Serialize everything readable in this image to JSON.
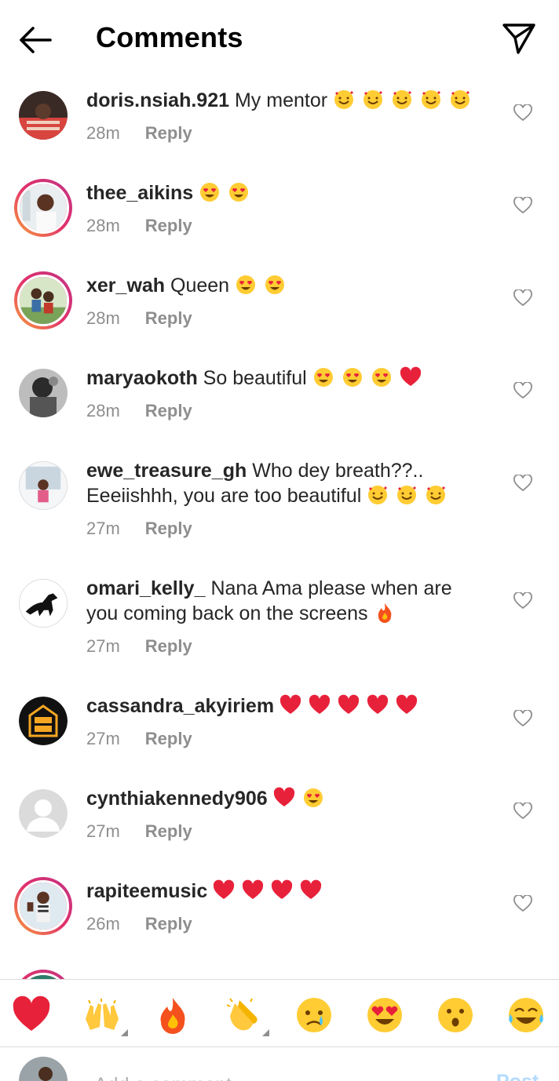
{
  "header": {
    "title": "Comments"
  },
  "comments": [
    {
      "user": "doris.nsiah.921",
      "text": "My mentor",
      "emojis": [
        "smiling-hearts",
        "smiling-hearts",
        "smiling-hearts",
        "smiling-hearts",
        "smiling-hearts"
      ],
      "time": "28m",
      "reply": "Reply"
    },
    {
      "user": "thee_aikins",
      "text": "",
      "emojis": [
        "heart-eyes",
        "heart-eyes"
      ],
      "time": "28m",
      "reply": "Reply"
    },
    {
      "user": "xer_wah",
      "text": "Queen",
      "emojis": [
        "heart-eyes",
        "heart-eyes"
      ],
      "time": "28m",
      "reply": "Reply"
    },
    {
      "user": "maryaokoth",
      "text": "So beautiful",
      "emojis": [
        "heart-eyes",
        "heart-eyes",
        "heart-eyes",
        "red-heart"
      ],
      "time": "28m",
      "reply": "Reply"
    },
    {
      "user": "ewe_treasure_gh",
      "text": "Who dey breath??..",
      "line2": "Eeeiishhh, you are too beautiful",
      "emojis": [
        "smiling-hearts",
        "smiling-hearts",
        "smiling-hearts"
      ],
      "time": "27m",
      "reply": "Reply"
    },
    {
      "user": "omari_kelly_",
      "text": "Nana Ama please when are",
      "line2": "you coming back on the screens",
      "emojis": [
        "fire"
      ],
      "time": "27m",
      "reply": "Reply"
    },
    {
      "user": "cassandra_akyiriem",
      "text": "",
      "emojis": [
        "red-heart",
        "red-heart",
        "red-heart",
        "red-heart",
        "red-heart"
      ],
      "time": "27m",
      "reply": "Reply"
    },
    {
      "user": "cynthiakennedy906",
      "text": "",
      "emojis": [
        "red-heart",
        "heart-eyes"
      ],
      "time": "27m",
      "reply": "Reply"
    },
    {
      "user": "rapiteemusic",
      "text": "",
      "emojis": [
        "red-heart",
        "red-heart",
        "red-heart",
        "red-heart"
      ],
      "time": "26m",
      "reply": "Reply"
    }
  ],
  "reactions": [
    "red-heart",
    "raising-hands",
    "fire",
    "clapping-hands",
    "crying-face",
    "heart-eyes",
    "surprised-face",
    "tears-of-joy"
  ],
  "composer": {
    "placeholder": "Add a comment...",
    "post_label": "Post"
  },
  "colors": {
    "accent": "#0095f6",
    "post_disabled": "#b3dbff",
    "heart": "#ed1c24",
    "muted": "#8e8e8e"
  }
}
